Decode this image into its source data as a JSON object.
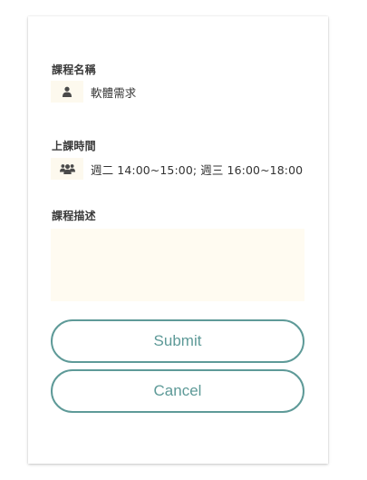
{
  "form": {
    "course_name_label": "課程名稱",
    "course_name_value": "軟體需求",
    "course_name_icon": "user-icon",
    "class_time_label": "上課時間",
    "class_time_value": "週二 14:00~15:00; 週三 16:00~18:00",
    "class_time_icon": "users-icon",
    "description_label": "課程描述",
    "description_value": "",
    "description_placeholder": ""
  },
  "buttons": {
    "submit_label": "Submit",
    "cancel_label": "Cancel"
  },
  "colors": {
    "accent": "#5e9a98",
    "field_background": "#fffbf1",
    "icon_background": "#fdf9ee",
    "text": "#333333"
  }
}
